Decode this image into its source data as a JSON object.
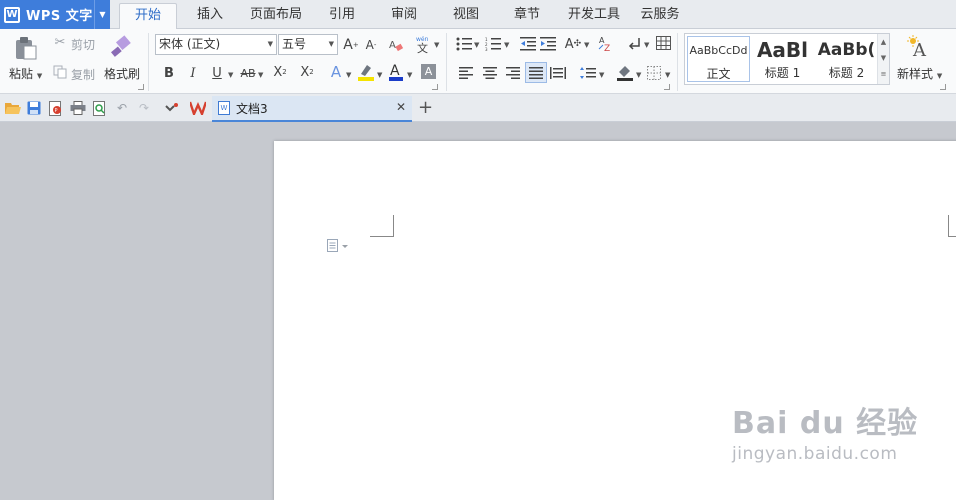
{
  "app": {
    "name": "WPS 文字",
    "logo": "W"
  },
  "menu_tabs": [
    {
      "label": "开始",
      "active": true
    },
    {
      "label": "插入"
    },
    {
      "label": "页面布局"
    },
    {
      "label": "引用"
    },
    {
      "label": "审阅"
    },
    {
      "label": "视图"
    },
    {
      "label": "章节"
    },
    {
      "label": "开发工具"
    },
    {
      "label": "云服务"
    }
  ],
  "clipboard": {
    "paste": "粘贴",
    "cut": "剪切",
    "copy": "复制",
    "format_painter": "格式刷"
  },
  "font": {
    "family": "宋体 (正文)",
    "size": "五号"
  },
  "styles": {
    "items": [
      {
        "sample": "AaBbCcDd",
        "name": "正文"
      },
      {
        "sample": "AaBl",
        "name": "标题 1"
      },
      {
        "sample": "AaBb(",
        "name": "标题 2"
      }
    ],
    "new_style": "新样式"
  },
  "document_tab": {
    "name": "文档3"
  },
  "watermark": {
    "brand": "Bai du 经验",
    "url": "jingyan.baidu.com"
  },
  "colors": {
    "accent": "#3e7ddb",
    "font_color_bar": "#1a3cc8",
    "highlight_bar": "#f5e300",
    "canvas": "#c6c9cf"
  }
}
